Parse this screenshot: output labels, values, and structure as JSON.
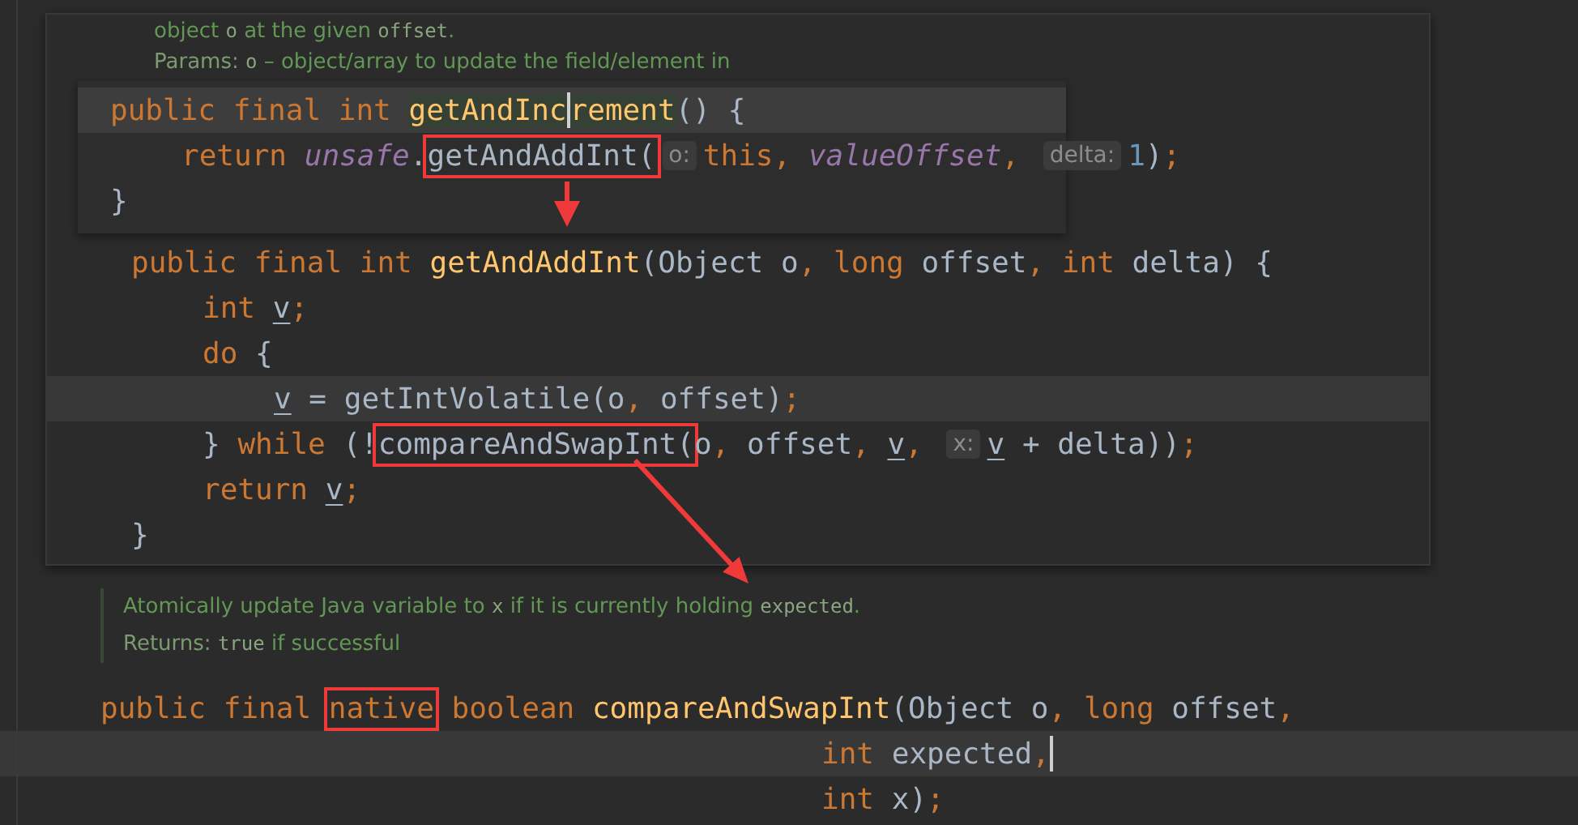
{
  "doc_popup": {
    "doc_lines": [
      [
        {
          "kind": "text",
          "text": "object "
        },
        {
          "kind": "code",
          "text": "o"
        },
        {
          "kind": "text",
          "text": " at the given "
        },
        {
          "kind": "code",
          "text": "offset"
        },
        {
          "kind": "text",
          "text": "."
        }
      ],
      [
        {
          "kind": "label",
          "text": "Params: "
        },
        {
          "kind": "code",
          "text": "o"
        },
        {
          "kind": "text",
          "text": " – object/array to update the field/element in"
        }
      ]
    ],
    "quick_definition": {
      "lines": [
        {
          "kind": "normal",
          "current": true,
          "tokens": [
            {
              "kind": "keyword",
              "text": "public final int "
            },
            {
              "kind": "usage",
              "text": "getAndInc"
            },
            {
              "kind": "caret"
            },
            {
              "kind": "usage",
              "text": "rement"
            },
            {
              "kind": "plain",
              "text": "() {"
            }
          ],
          "children": [
            {
              "kind": "normal",
              "current": false,
              "tokens": [
                {
                  "kind": "keyword",
                  "text": "return "
                },
                {
                  "kind": "field",
                  "text": "unsafe"
                },
                {
                  "kind": "plain",
                  "text": "."
                },
                {
                  "kind": "box",
                  "tokens": [
                    {
                      "kind": "plain",
                      "text": "getAndAddInt("
                    }
                  ]
                },
                {
                  "kind": "hint",
                  "text": "o:"
                },
                {
                  "kind": "keyword",
                  "text": "this"
                },
                {
                  "kind": "punct",
                  "text": ", "
                },
                {
                  "kind": "field",
                  "text": "valueOffset"
                },
                {
                  "kind": "punct",
                  "text": ", "
                },
                {
                  "kind": "hint",
                  "text": "delta:"
                },
                {
                  "kind": "number",
                  "text": "1"
                },
                {
                  "kind": "plain",
                  "text": ")"
                },
                {
                  "kind": "punct",
                  "text": ";"
                }
              ]
            }
          ]
        },
        {
          "kind": "normal",
          "current": false,
          "tokens": [
            {
              "kind": "plain",
              "text": "}"
            }
          ]
        }
      ]
    },
    "definition": {
      "lines": [
        {
          "kind": "normal",
          "current": false,
          "tokens": [
            {
              "kind": "keyword",
              "text": "public final int "
            },
            {
              "kind": "method",
              "text": "getAndAddInt"
            },
            {
              "kind": "plain",
              "text": "(Object o"
            },
            {
              "kind": "punct",
              "text": ", "
            },
            {
              "kind": "keyword",
              "text": "long "
            },
            {
              "kind": "plain",
              "text": "offset"
            },
            {
              "kind": "punct",
              "text": ", "
            },
            {
              "kind": "keyword",
              "text": "int "
            },
            {
              "kind": "plain",
              "text": "delta) {"
            }
          ],
          "children": [
            {
              "kind": "normal",
              "current": false,
              "tokens": [
                {
                  "kind": "keyword",
                  "text": "int "
                },
                {
                  "kind": "local",
                  "text": "v"
                },
                {
                  "kind": "punct",
                  "text": ";"
                }
              ]
            },
            {
              "kind": "normal",
              "current": false,
              "tokens": [
                {
                  "kind": "keyword",
                  "text": "do "
                },
                {
                  "kind": "plain",
                  "text": "{"
                }
              ],
              "children": [
                {
                  "kind": "normal",
                  "current": true,
                  "tokens": [
                    {
                      "kind": "local",
                      "text": "v"
                    },
                    {
                      "kind": "plain",
                      "text": " = getIntVolatile(o"
                    },
                    {
                      "kind": "punct",
                      "text": ", "
                    },
                    {
                      "kind": "plain",
                      "text": "offset)"
                    },
                    {
                      "kind": "punct",
                      "text": ";"
                    }
                  ]
                }
              ]
            },
            {
              "kind": "normal",
              "current": false,
              "tokens": [
                {
                  "kind": "plain",
                  "text": "} "
                },
                {
                  "kind": "keyword",
                  "text": "while "
                },
                {
                  "kind": "plain",
                  "text": "(!"
                },
                {
                  "kind": "box",
                  "tokens": [
                    {
                      "kind": "plain",
                      "text": "compareAndSwapInt("
                    }
                  ]
                },
                {
                  "kind": "plain",
                  "text": "o"
                },
                {
                  "kind": "punct",
                  "text": ", "
                },
                {
                  "kind": "plain",
                  "text": "offset"
                },
                {
                  "kind": "punct",
                  "text": ", "
                },
                {
                  "kind": "local",
                  "text": "v"
                },
                {
                  "kind": "punct",
                  "text": ", "
                },
                {
                  "kind": "hint",
                  "text": "x:"
                },
                {
                  "kind": "local",
                  "text": "v"
                },
                {
                  "kind": "plain",
                  "text": " + delta))"
                },
                {
                  "kind": "punct",
                  "text": ";"
                }
              ]
            },
            {
              "kind": "normal",
              "current": false,
              "tokens": [
                {
                  "kind": "keyword",
                  "text": "return "
                },
                {
                  "kind": "local",
                  "text": "v"
                },
                {
                  "kind": "punct",
                  "text": ";"
                }
              ]
            }
          ]
        },
        {
          "kind": "normal",
          "current": false,
          "tokens": [
            {
              "kind": "plain",
              "text": "}"
            }
          ]
        }
      ]
    }
  },
  "doc_comment": {
    "lines": [
      [
        {
          "kind": "text",
          "text": "Atomically update Java variable to "
        },
        {
          "kind": "code",
          "text": "x"
        },
        {
          "kind": "text",
          "text": " if it is currently holding "
        },
        {
          "kind": "code",
          "text": "expected"
        },
        {
          "kind": "text",
          "text": "."
        }
      ],
      [
        {
          "kind": "label",
          "text": "Returns: "
        },
        {
          "kind": "code",
          "text": "true"
        },
        {
          "kind": "text",
          "text": " if successful"
        }
      ]
    ]
  },
  "code": {
    "lines": [
      {
        "kind": "normal",
        "current": false,
        "tokens": [
          {
            "kind": "keyword",
            "text": "public final "
          },
          {
            "kind": "box",
            "tokens": [
              {
                "kind": "keyword",
                "text": "native"
              }
            ]
          },
          {
            "kind": "keyword",
            "text": " boolean "
          },
          {
            "kind": "method",
            "text": "compareAndSwapInt"
          },
          {
            "kind": "plain",
            "text": "(Object o"
          },
          {
            "kind": "punct",
            "text": ", "
          },
          {
            "kind": "keyword",
            "text": "long "
          },
          {
            "kind": "plain",
            "text": "offset"
          },
          {
            "kind": "punct",
            "text": ","
          }
        ]
      },
      {
        "kind": "wrapped",
        "current": true,
        "tokens": [
          {
            "kind": "keyword",
            "text": "int "
          },
          {
            "kind": "plain",
            "text": "expected"
          },
          {
            "kind": "punct",
            "text": ","
          },
          {
            "kind": "caret"
          }
        ]
      },
      {
        "kind": "wrapped",
        "current": false,
        "tokens": [
          {
            "kind": "keyword",
            "text": "int "
          },
          {
            "kind": "plain",
            "text": "x)"
          },
          {
            "kind": "punct",
            "text": ";"
          }
        ]
      }
    ]
  }
}
